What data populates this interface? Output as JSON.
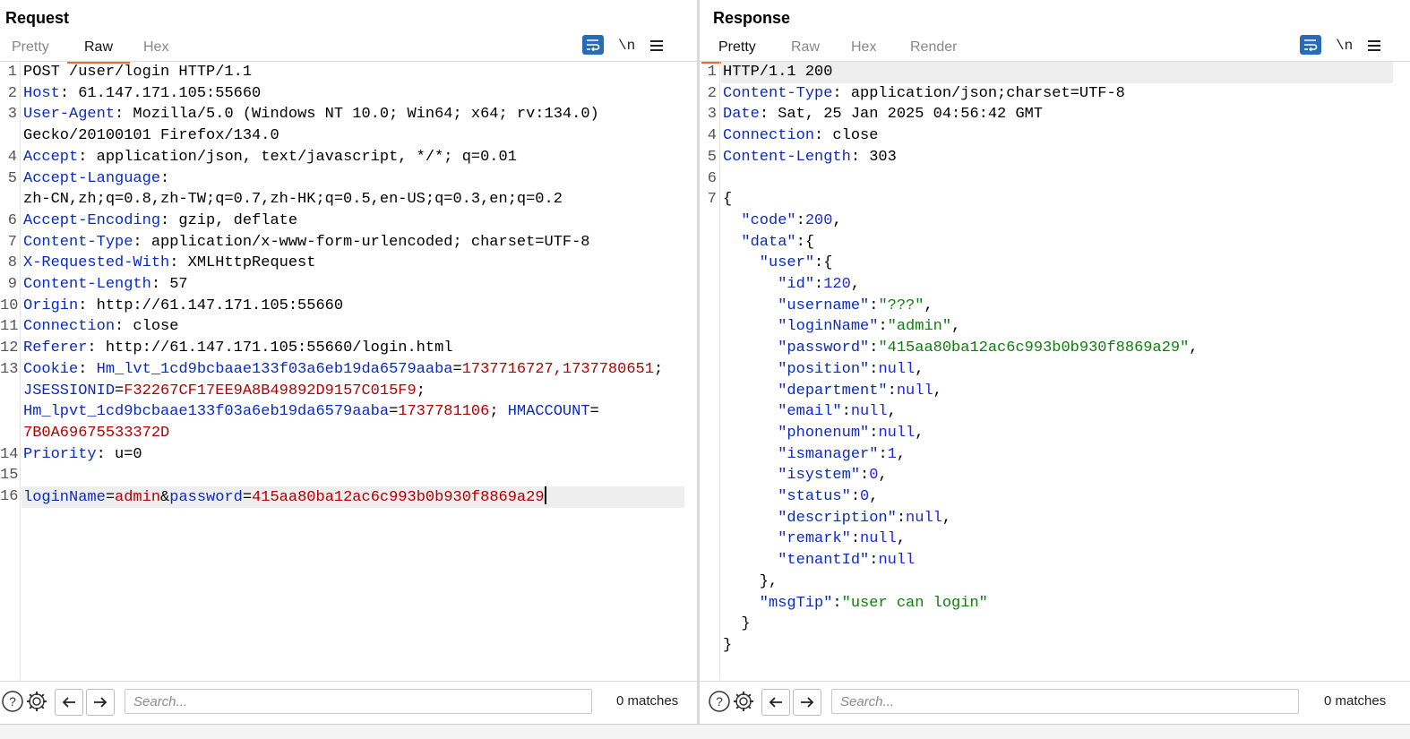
{
  "request": {
    "title": "Request",
    "tabs": [
      "Pretty",
      "Raw",
      "Hex"
    ],
    "active_tab": "Raw",
    "newline_label": "\\n",
    "search_placeholder": "Search...",
    "matches": "0 matches",
    "lines": [
      {
        "n": "1",
        "segs": [
          {
            "t": "POST /user/login HTTP/1.1",
            "c": ""
          }
        ]
      },
      {
        "n": "2",
        "segs": [
          {
            "t": "Host",
            "c": "k"
          },
          {
            "t": ": 61.147.171.105:55660",
            "c": ""
          }
        ]
      },
      {
        "n": "3",
        "segs": [
          {
            "t": "User-Agent",
            "c": "k"
          },
          {
            "t": ": Mozilla/5.0 (Windows NT 10.0; Win64; x64; rv:134.0)",
            "c": ""
          }
        ]
      },
      {
        "n": "",
        "segs": [
          {
            "t": "Gecko/20100101 Firefox/134.0",
            "c": ""
          }
        ]
      },
      {
        "n": "4",
        "segs": [
          {
            "t": "Accept",
            "c": "k"
          },
          {
            "t": ": application/json, text/javascript, */*; q=0.01",
            "c": ""
          }
        ]
      },
      {
        "n": "5",
        "segs": [
          {
            "t": "Accept-Language",
            "c": "k"
          },
          {
            "t": ":",
            "c": ""
          }
        ]
      },
      {
        "n": "",
        "segs": [
          {
            "t": "zh-CN,zh;q=0.8,zh-TW;q=0.7,zh-HK;q=0.5,en-US;q=0.3,en;q=0.2",
            "c": ""
          }
        ]
      },
      {
        "n": "6",
        "segs": [
          {
            "t": "Accept-Encoding",
            "c": "k"
          },
          {
            "t": ": gzip, deflate",
            "c": ""
          }
        ]
      },
      {
        "n": "7",
        "segs": [
          {
            "t": "Content-Type",
            "c": "k"
          },
          {
            "t": ": application/x-www-form-urlencoded; charset=UTF-8",
            "c": ""
          }
        ]
      },
      {
        "n": "8",
        "segs": [
          {
            "t": "X-Requested-With",
            "c": "k"
          },
          {
            "t": ": XMLHttpRequest",
            "c": ""
          }
        ]
      },
      {
        "n": "9",
        "segs": [
          {
            "t": "Content-Length",
            "c": "k"
          },
          {
            "t": ": 57",
            "c": ""
          }
        ]
      },
      {
        "n": "10",
        "segs": [
          {
            "t": "Origin",
            "c": "k"
          },
          {
            "t": ": http://61.147.171.105:55660",
            "c": ""
          }
        ]
      },
      {
        "n": "11",
        "segs": [
          {
            "t": "Connection",
            "c": "k"
          },
          {
            "t": ": close",
            "c": ""
          }
        ]
      },
      {
        "n": "12",
        "segs": [
          {
            "t": "Referer",
            "c": "k"
          },
          {
            "t": ": http://61.147.171.105:55660/login.html",
            "c": ""
          }
        ]
      },
      {
        "n": "13",
        "segs": [
          {
            "t": "Cookie",
            "c": "k"
          },
          {
            "t": ": ",
            "c": ""
          },
          {
            "t": "Hm_lvt_1cd9bcbaae133f03a6eb19da6579aaba",
            "c": "k"
          },
          {
            "t": "=",
            "c": ""
          },
          {
            "t": "1737716727,1737780651",
            "c": "v"
          },
          {
            "t": ";",
            "c": ""
          }
        ]
      },
      {
        "n": "",
        "segs": [
          {
            "t": "JSESSIONID",
            "c": "k"
          },
          {
            "t": "=",
            "c": ""
          },
          {
            "t": "F32267CF17EE9A8B49892D9157C015F9",
            "c": "v"
          },
          {
            "t": ";",
            "c": ""
          }
        ]
      },
      {
        "n": "",
        "segs": [
          {
            "t": "Hm_lpvt_1cd9bcbaae133f03a6eb19da6579aaba",
            "c": "k"
          },
          {
            "t": "=",
            "c": ""
          },
          {
            "t": "1737781106",
            "c": "v"
          },
          {
            "t": "; ",
            "c": ""
          },
          {
            "t": "HMACCOUNT",
            "c": "k"
          },
          {
            "t": "=",
            "c": ""
          }
        ]
      },
      {
        "n": "",
        "segs": [
          {
            "t": "7B0A69675533372D",
            "c": "v"
          }
        ]
      },
      {
        "n": "14",
        "segs": [
          {
            "t": "Priority",
            "c": "k"
          },
          {
            "t": ": u=0",
            "c": ""
          }
        ]
      },
      {
        "n": "15",
        "segs": []
      },
      {
        "n": "16",
        "segs": [
          {
            "t": "loginName",
            "c": "k"
          },
          {
            "t": "=",
            "c": ""
          },
          {
            "t": "admin",
            "c": "v"
          },
          {
            "t": "&",
            "c": ""
          },
          {
            "t": "password",
            "c": "k"
          },
          {
            "t": "=",
            "c": ""
          },
          {
            "t": "415aa80ba12ac6c993b0b930f8869a29",
            "c": "v"
          }
        ],
        "caret": true,
        "highlight": true
      }
    ]
  },
  "response": {
    "title": "Response",
    "tabs": [
      "Pretty",
      "Raw",
      "Hex",
      "Render"
    ],
    "active_tab": "Pretty",
    "newline_label": "\\n",
    "search_placeholder": "Search...",
    "matches": "0 matches",
    "lines": [
      {
        "n": "1",
        "segs": [
          {
            "t": "HTTP/1.1 200",
            "c": ""
          }
        ],
        "highlight": true
      },
      {
        "n": "2",
        "segs": [
          {
            "t": "Content-Type",
            "c": "k"
          },
          {
            "t": ": application/json;charset=UTF-8",
            "c": ""
          }
        ]
      },
      {
        "n": "3",
        "segs": [
          {
            "t": "Date",
            "c": "k"
          },
          {
            "t": ": Sat, 25 Jan 2025 04:56:42 GMT",
            "c": ""
          }
        ]
      },
      {
        "n": "4",
        "segs": [
          {
            "t": "Connection",
            "c": "k"
          },
          {
            "t": ": close",
            "c": ""
          }
        ]
      },
      {
        "n": "5",
        "segs": [
          {
            "t": "Content-Length",
            "c": "k"
          },
          {
            "t": ": 303",
            "c": ""
          }
        ]
      },
      {
        "n": "6",
        "segs": []
      },
      {
        "n": "7",
        "segs": [
          {
            "t": "{",
            "c": ""
          }
        ]
      },
      {
        "n": "",
        "segs": [
          {
            "t": "  \"code\"",
            "c": "k"
          },
          {
            "t": ":",
            "c": ""
          },
          {
            "t": "200",
            "c": "n"
          },
          {
            "t": ",",
            "c": ""
          }
        ]
      },
      {
        "n": "",
        "segs": [
          {
            "t": "  \"data\"",
            "c": "k"
          },
          {
            "t": ":{",
            "c": ""
          }
        ]
      },
      {
        "n": "",
        "segs": [
          {
            "t": "    \"user\"",
            "c": "k"
          },
          {
            "t": ":{",
            "c": ""
          }
        ]
      },
      {
        "n": "",
        "segs": [
          {
            "t": "      \"id\"",
            "c": "k"
          },
          {
            "t": ":",
            "c": ""
          },
          {
            "t": "120",
            "c": "n"
          },
          {
            "t": ",",
            "c": ""
          }
        ]
      },
      {
        "n": "",
        "segs": [
          {
            "t": "      \"username\"",
            "c": "k"
          },
          {
            "t": ":",
            "c": ""
          },
          {
            "t": "\"???\"",
            "c": "s"
          },
          {
            "t": ",",
            "c": ""
          }
        ]
      },
      {
        "n": "",
        "segs": [
          {
            "t": "      \"loginName\"",
            "c": "k"
          },
          {
            "t": ":",
            "c": ""
          },
          {
            "t": "\"admin\"",
            "c": "s"
          },
          {
            "t": ",",
            "c": ""
          }
        ]
      },
      {
        "n": "",
        "segs": [
          {
            "t": "      \"password\"",
            "c": "k"
          },
          {
            "t": ":",
            "c": ""
          },
          {
            "t": "\"415aa80ba12ac6c993b0b930f8869a29\"",
            "c": "s"
          },
          {
            "t": ",",
            "c": ""
          }
        ]
      },
      {
        "n": "",
        "segs": [
          {
            "t": "      \"position\"",
            "c": "k"
          },
          {
            "t": ":",
            "c": ""
          },
          {
            "t": "null",
            "c": "n"
          },
          {
            "t": ",",
            "c": ""
          }
        ]
      },
      {
        "n": "",
        "segs": [
          {
            "t": "      \"department\"",
            "c": "k"
          },
          {
            "t": ":",
            "c": ""
          },
          {
            "t": "null",
            "c": "n"
          },
          {
            "t": ",",
            "c": ""
          }
        ]
      },
      {
        "n": "",
        "segs": [
          {
            "t": "      \"email\"",
            "c": "k"
          },
          {
            "t": ":",
            "c": ""
          },
          {
            "t": "null",
            "c": "n"
          },
          {
            "t": ",",
            "c": ""
          }
        ]
      },
      {
        "n": "",
        "segs": [
          {
            "t": "      \"phonenum\"",
            "c": "k"
          },
          {
            "t": ":",
            "c": ""
          },
          {
            "t": "null",
            "c": "n"
          },
          {
            "t": ",",
            "c": ""
          }
        ]
      },
      {
        "n": "",
        "segs": [
          {
            "t": "      \"ismanager\"",
            "c": "k"
          },
          {
            "t": ":",
            "c": ""
          },
          {
            "t": "1",
            "c": "n"
          },
          {
            "t": ",",
            "c": ""
          }
        ]
      },
      {
        "n": "",
        "segs": [
          {
            "t": "      \"isystem\"",
            "c": "k"
          },
          {
            "t": ":",
            "c": ""
          },
          {
            "t": "0",
            "c": "n"
          },
          {
            "t": ",",
            "c": ""
          }
        ]
      },
      {
        "n": "",
        "segs": [
          {
            "t": "      \"status\"",
            "c": "k"
          },
          {
            "t": ":",
            "c": ""
          },
          {
            "t": "0",
            "c": "n"
          },
          {
            "t": ",",
            "c": ""
          }
        ]
      },
      {
        "n": "",
        "segs": [
          {
            "t": "      \"description\"",
            "c": "k"
          },
          {
            "t": ":",
            "c": ""
          },
          {
            "t": "null",
            "c": "n"
          },
          {
            "t": ",",
            "c": ""
          }
        ]
      },
      {
        "n": "",
        "segs": [
          {
            "t": "      \"remark\"",
            "c": "k"
          },
          {
            "t": ":",
            "c": ""
          },
          {
            "t": "null",
            "c": "n"
          },
          {
            "t": ",",
            "c": ""
          }
        ]
      },
      {
        "n": "",
        "segs": [
          {
            "t": "      \"tenantId\"",
            "c": "k"
          },
          {
            "t": ":",
            "c": ""
          },
          {
            "t": "null",
            "c": "n"
          }
        ]
      },
      {
        "n": "",
        "segs": [
          {
            "t": "    },",
            "c": ""
          }
        ]
      },
      {
        "n": "",
        "segs": [
          {
            "t": "    \"msgTip\"",
            "c": "k"
          },
          {
            "t": ":",
            "c": ""
          },
          {
            "t": "\"user can login\"",
            "c": "s"
          }
        ]
      },
      {
        "n": "",
        "segs": [
          {
            "t": "  }",
            "c": ""
          }
        ]
      },
      {
        "n": "",
        "segs": [
          {
            "t": "}",
            "c": ""
          }
        ]
      }
    ]
  }
}
